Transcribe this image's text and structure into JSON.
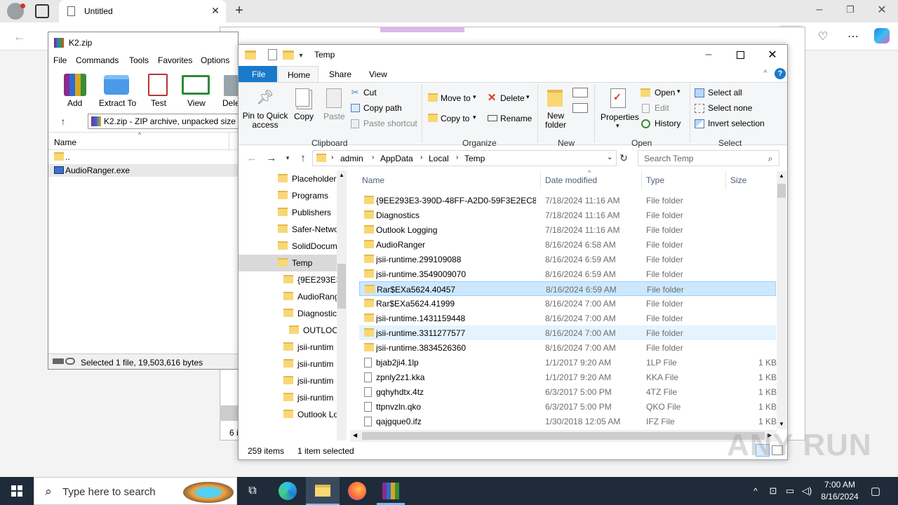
{
  "browser": {
    "tab_title": "Untitled"
  },
  "winrar": {
    "title": "K2.zip",
    "menu": [
      "File",
      "Commands",
      "Tools",
      "Favorites",
      "Options"
    ],
    "toolbar": [
      "Add",
      "Extract To",
      "Test",
      "View",
      "Dele"
    ],
    "path": "K2.zip - ZIP archive, unpacked size 1",
    "column_name": "Name",
    "rows": [
      "..",
      "AudioRanger.exe"
    ],
    "status": "Selected 1 file, 19,503,616 bytes"
  },
  "explorer": {
    "title": "Temp",
    "tabs": [
      "File",
      "Home",
      "Share",
      "View"
    ],
    "ribbon": {
      "pin": "Pin to Quick access",
      "copy": "Copy",
      "paste": "Paste",
      "cut": "Cut",
      "copy_path": "Copy path",
      "paste_shortcut": "Paste shortcut",
      "move_to": "Move to",
      "copy_to": "Copy to",
      "delete": "Delete",
      "rename": "Rename",
      "new_folder": "New folder",
      "properties": "Properties",
      "open": "Open",
      "edit": "Edit",
      "history": "History",
      "select_all": "Select all",
      "select_none": "Select none",
      "invert_selection": "Invert selection",
      "groups": [
        "Clipboard",
        "Organize",
        "New",
        "Open",
        "Select"
      ]
    },
    "address": [
      "admin",
      "AppData",
      "Local",
      "Temp"
    ],
    "search_placeholder": "Search Temp",
    "columns": [
      "Name",
      "Date modified",
      "Type",
      "Size"
    ],
    "nav": [
      "Placeholder",
      "Programs",
      "Publishers",
      "Safer-Netwo",
      "SolidDocum",
      "Temp",
      "{9EE293E3-",
      "AudioRang",
      "Diagnostic",
      "OUTLOO",
      "jsii-runtim",
      "jsii-runtim",
      "jsii-runtim",
      "jsii-runtim",
      "Outlook Lo"
    ],
    "files": [
      {
        "name": "{9EE293E3-390D-48FF-A2D0-59F3E2EC88...",
        "date": "7/18/2024 11:16 AM",
        "type": "File folder",
        "size": "",
        "kind": "folder"
      },
      {
        "name": "Diagnostics",
        "date": "7/18/2024 11:16 AM",
        "type": "File folder",
        "size": "",
        "kind": "folder"
      },
      {
        "name": "Outlook Logging",
        "date": "7/18/2024 11:16 AM",
        "type": "File folder",
        "size": "",
        "kind": "folder"
      },
      {
        "name": "AudioRanger",
        "date": "8/16/2024 6:58 AM",
        "type": "File folder",
        "size": "",
        "kind": "folder"
      },
      {
        "name": "jsii-runtime.299109088",
        "date": "8/16/2024 6:59 AM",
        "type": "File folder",
        "size": "",
        "kind": "folder"
      },
      {
        "name": "jsii-runtime.3549009070",
        "date": "8/16/2024 6:59 AM",
        "type": "File folder",
        "size": "",
        "kind": "folder"
      },
      {
        "name": "Rar$EXa5624.40457",
        "date": "8/16/2024 6:59 AM",
        "type": "File folder",
        "size": "",
        "kind": "folder"
      },
      {
        "name": "Rar$EXa5624.41999",
        "date": "8/16/2024 7:00 AM",
        "type": "File folder",
        "size": "",
        "kind": "folder"
      },
      {
        "name": "jsii-runtime.1431159448",
        "date": "8/16/2024 7:00 AM",
        "type": "File folder",
        "size": "",
        "kind": "folder"
      },
      {
        "name": "jsii-runtime.3311277577",
        "date": "8/16/2024 7:00 AM",
        "type": "File folder",
        "size": "",
        "kind": "folder"
      },
      {
        "name": "jsii-runtime.3834526360",
        "date": "8/16/2024 7:00 AM",
        "type": "File folder",
        "size": "",
        "kind": "folder"
      },
      {
        "name": "bjab2ji4.1lp",
        "date": "1/1/2017 9:20 AM",
        "type": "1LP File",
        "size": "1 KB",
        "kind": "file"
      },
      {
        "name": "zpnly2z1.kka",
        "date": "1/1/2017 9:20 AM",
        "type": "KKA File",
        "size": "1 KB",
        "kind": "file"
      },
      {
        "name": "gqhyhdtx.4tz",
        "date": "6/3/2017 5:00 PM",
        "type": "4TZ File",
        "size": "1 KB",
        "kind": "file"
      },
      {
        "name": "ttpnvzln.qko",
        "date": "6/3/2017 5:00 PM",
        "type": "QKO File",
        "size": "1 KB",
        "kind": "file"
      },
      {
        "name": "qajgque0.ifz",
        "date": "1/30/2018 12:05 AM",
        "type": "IFZ File",
        "size": "1 KB",
        "kind": "file"
      }
    ],
    "status_items": "259 items",
    "status_selected": "1 item selected"
  },
  "taskbar": {
    "search_placeholder": "Type here to search",
    "time": "7:00 AM",
    "date": "8/16/2024"
  },
  "watermark": "ANY RUN"
}
